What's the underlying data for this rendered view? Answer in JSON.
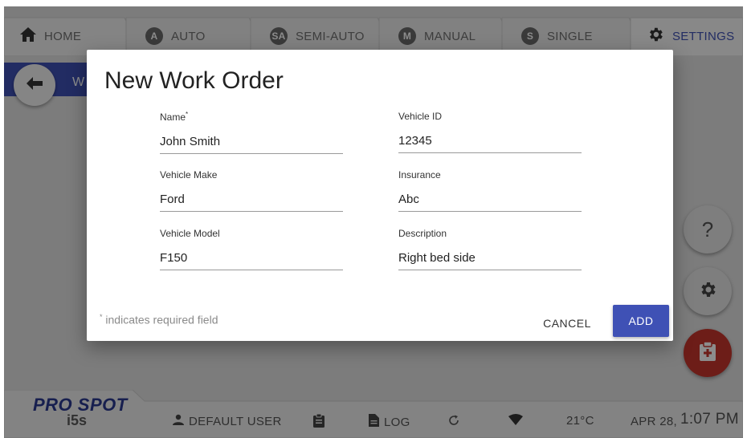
{
  "tabs": [
    {
      "label": "HOME",
      "badge": "",
      "icon": "home-icon"
    },
    {
      "label": "AUTO",
      "badge": "A",
      "icon": ""
    },
    {
      "label": "SEMI-AUTO",
      "badge": "SA",
      "icon": ""
    },
    {
      "label": "MANUAL",
      "badge": "M",
      "icon": ""
    },
    {
      "label": "SINGLE",
      "badge": "S",
      "icon": ""
    },
    {
      "label": "SETTINGS",
      "badge": "",
      "icon": "gear-icon",
      "active": true
    }
  ],
  "subheader": {
    "text": "W"
  },
  "dialog": {
    "title": "New Work Order",
    "fields": [
      {
        "label": "Name",
        "required_mark": "*",
        "value": "John Smith"
      },
      {
        "label": "Vehicle ID",
        "required_mark": "",
        "value": "12345"
      },
      {
        "label": "Vehicle Make",
        "required_mark": "",
        "value": "Ford"
      },
      {
        "label": "Insurance",
        "required_mark": "",
        "value": "Abc"
      },
      {
        "label": "Vehicle Model",
        "required_mark": "",
        "value": "F150"
      },
      {
        "label": "Description",
        "required_mark": "",
        "value": "Right bed side"
      }
    ],
    "required_note_mark": "*",
    "required_note": " indicates required field",
    "cancel_label": "CANCEL",
    "add_label": "ADD"
  },
  "fabs": {
    "help_label": "?"
  },
  "statusbar": {
    "logo_line1": "PRO SPOT",
    "logo_line2": "i5s",
    "user": "DEFAULT USER",
    "log": "LOG",
    "temperature": "21°C",
    "date": "APR 28,",
    "time": "1:07 PM"
  },
  "colors": {
    "accent": "#3f51b5",
    "fab_red": "#c7352c",
    "background": "#e2e2e2"
  }
}
